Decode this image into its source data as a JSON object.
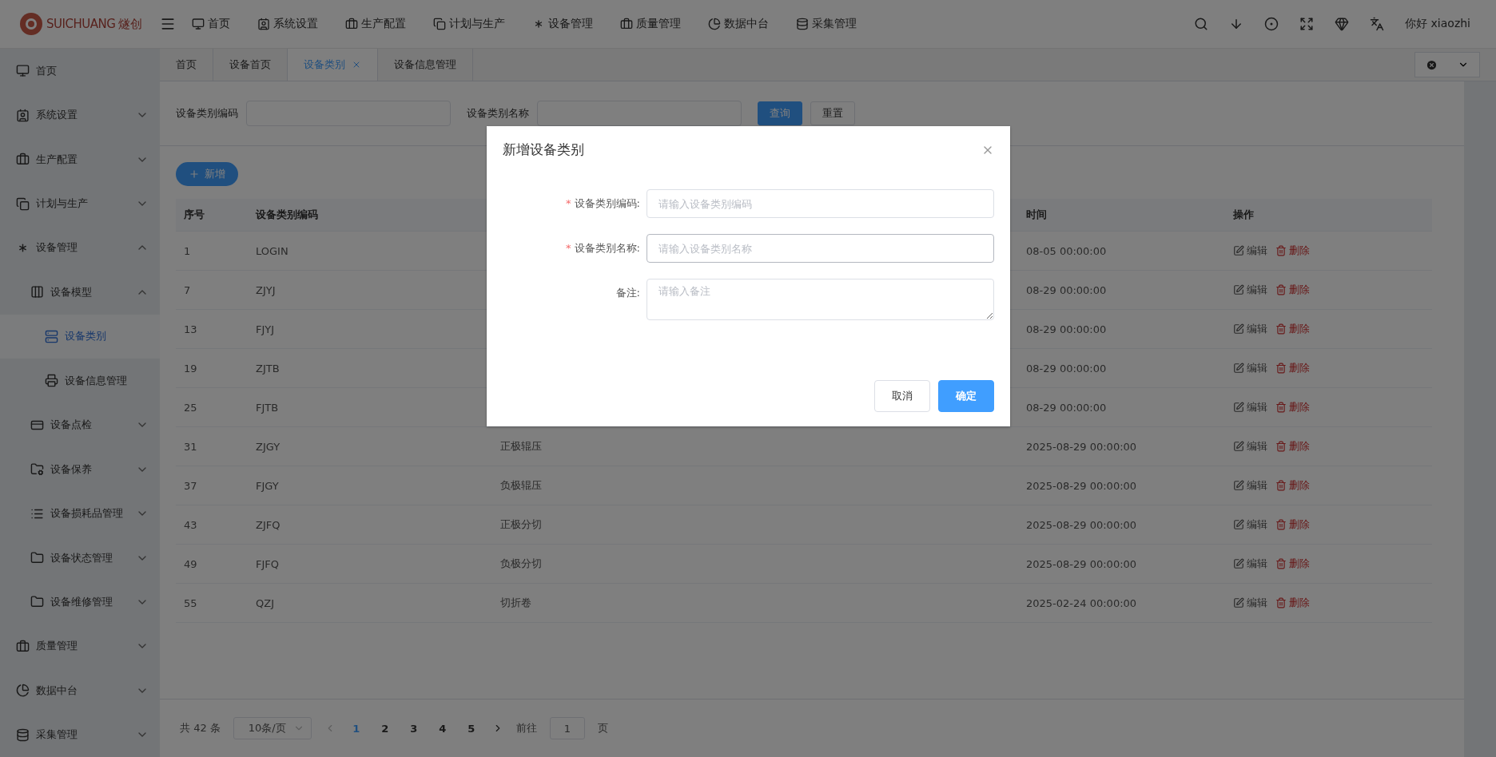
{
  "logo": {
    "name": "SUICHUANG",
    "name_cn": "燧创"
  },
  "top_nav": [
    {
      "label": "首页"
    },
    {
      "label": "系统设置"
    },
    {
      "label": "生产配置"
    },
    {
      "label": "计划与生产"
    },
    {
      "label": "设备管理"
    },
    {
      "label": "质量管理"
    },
    {
      "label": "数据中台"
    },
    {
      "label": "采集管理"
    }
  ],
  "user": {
    "greeting": "你好 xiaozhi"
  },
  "sidebar": {
    "items": [
      {
        "label": "首页",
        "selected": false
      },
      {
        "label": "系统设置",
        "expanded": false,
        "selected": false
      },
      {
        "label": "生产配置",
        "expanded": false,
        "selected": false
      },
      {
        "label": "计划与生产",
        "expanded": false,
        "selected": false
      },
      {
        "label": "设备管理",
        "expanded": true,
        "selected": false,
        "children": [
          {
            "label": "设备模型",
            "expanded": true,
            "selected": false,
            "children": [
              {
                "label": "设备类别",
                "selected": true
              },
              {
                "label": "设备信息管理",
                "selected": false
              }
            ]
          },
          {
            "label": "设备点检",
            "expanded": false,
            "selected": false
          },
          {
            "label": "设备保养",
            "expanded": false,
            "selected": false
          },
          {
            "label": "设备损耗品管理",
            "expanded": false,
            "selected": false
          },
          {
            "label": "设备状态管理",
            "expanded": false,
            "selected": false
          },
          {
            "label": "设备维修管理",
            "expanded": false,
            "selected": false
          }
        ]
      },
      {
        "label": "质量管理",
        "expanded": false,
        "selected": false
      },
      {
        "label": "数据中台",
        "expanded": false,
        "selected": false
      },
      {
        "label": "采集管理",
        "expanded": false,
        "selected": false
      }
    ]
  },
  "tabs": [
    {
      "label": "首页",
      "selected": false,
      "closable": false
    },
    {
      "label": "设备首页",
      "selected": false,
      "closable": false
    },
    {
      "label": "设备类别",
      "selected": true,
      "closable": true
    },
    {
      "label": "设备信息管理",
      "selected": false,
      "closable": false
    }
  ],
  "search": {
    "fields": [
      {
        "label": "设备类别编码"
      },
      {
        "label": "设备类别名称"
      }
    ],
    "buttons": [
      {
        "label": "查询",
        "kind": "primary"
      },
      {
        "label": "重置",
        "kind": "default"
      }
    ]
  },
  "add_button": {
    "label": "新增"
  },
  "table": {
    "columns": [
      {
        "label": "序号"
      },
      {
        "label": "设备类别编码"
      },
      {
        "label": "时间"
      },
      {
        "label": "操作"
      }
    ],
    "rows": [
      {
        "no": "1",
        "code": "LOGIN",
        "time": "08-05 00:00:00",
        "actions": [
          "编辑",
          "删除"
        ]
      },
      {
        "no": "7",
        "code": "ZJYJ",
        "time": "08-29 00:00:00",
        "actions": [
          "编辑",
          "删除"
        ]
      },
      {
        "no": "13",
        "code": "FJYJ",
        "time": "08-29 00:00:00",
        "actions": [
          "编辑",
          "删除"
        ]
      },
      {
        "no": "19",
        "code": "ZJTB",
        "time": "08-29 00:00:00",
        "actions": [
          "编辑",
          "删除"
        ]
      },
      {
        "no": "25",
        "code": "FJTB",
        "time": "08-29 00:00:00",
        "actions": [
          "编辑",
          "删除"
        ]
      },
      {
        "no": "31",
        "code": "ZJGY",
        "name": "正极辊压",
        "time": "2025-08-29 00:00:00",
        "actions": [
          "编辑",
          "删除"
        ]
      },
      {
        "no": "37",
        "code": "FJGY",
        "name": "负极辊压",
        "time": "2025-08-29 00:00:00",
        "actions": [
          "编辑",
          "删除"
        ]
      },
      {
        "no": "43",
        "code": "ZJFQ",
        "name": "正极分切",
        "time": "2025-08-29 00:00:00",
        "actions": [
          "编辑",
          "删除"
        ]
      },
      {
        "no": "49",
        "code": "FJFQ",
        "name": "负极分切",
        "time": "2025-08-29 00:00:00",
        "actions": [
          "编辑",
          "删除"
        ]
      },
      {
        "no": "55",
        "code": "QZJ",
        "name": "切折卷",
        "time": "2025-02-24 00:00:00",
        "actions": [
          "编辑",
          "删除"
        ]
      }
    ]
  },
  "pagination": {
    "total": "共 42 条",
    "page_size": "10条/页",
    "pages": [
      {
        "label": "1",
        "selected": true
      },
      {
        "label": "2",
        "selected": false
      },
      {
        "label": "3",
        "selected": false
      },
      {
        "label": "4",
        "selected": false
      },
      {
        "label": "5",
        "selected": false
      }
    ],
    "goto_label": "前往",
    "goto_value": "1",
    "goto_suffix": "页"
  },
  "dialog": {
    "title": "新增设备类别",
    "fields": [
      {
        "label": "设备类别编码:",
        "required_mark": "*",
        "placeholder": "请输入设备类别编码",
        "kind": "input",
        "focused": false
      },
      {
        "label": "设备类别名称:",
        "required_mark": "*",
        "placeholder": "请输入设备类别名称",
        "kind": "input",
        "focused": true
      },
      {
        "label": "备注:",
        "placeholder": "请输入备注",
        "kind": "textarea",
        "focused": false
      }
    ],
    "buttons": [
      {
        "label": "取消",
        "kind": "default"
      },
      {
        "label": "确定",
        "kind": "primary"
      }
    ]
  }
}
